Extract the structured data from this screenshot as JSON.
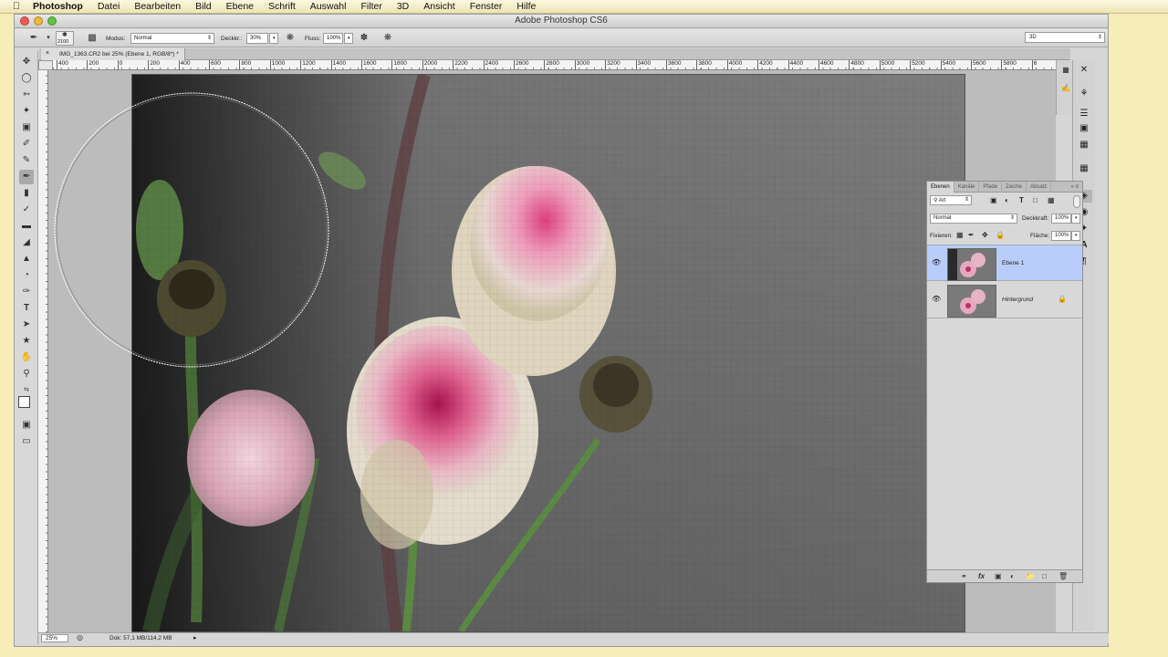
{
  "menubar": {
    "app": "Photoshop",
    "items": [
      "Datei",
      "Bearbeiten",
      "Bild",
      "Ebene",
      "Schrift",
      "Auswahl",
      "Filter",
      "3D",
      "Ansicht",
      "Fenster",
      "Hilfe"
    ]
  },
  "window": {
    "title": "Adobe Photoshop CS6"
  },
  "options": {
    "brush_size": "2100",
    "mode_label": "Modus:",
    "mode_value": "Normal",
    "opacity_label": "Deckkr.:",
    "opacity_value": "30%",
    "flow_label": "Fluss:",
    "flow_value": "100%",
    "workspace": "3D"
  },
  "document": {
    "tab": "IMG_1363.CR2 bei 25% (Ebene 1, RGB/8*) *"
  },
  "ruler": {
    "h": [
      "400",
      "200",
      "0",
      "200",
      "400",
      "600",
      "800",
      "1000",
      "1200",
      "1400",
      "1600",
      "1800",
      "2000",
      "2200",
      "2400",
      "2600",
      "2800",
      "3000",
      "3200",
      "3400",
      "3600",
      "3800",
      "4000",
      "4200",
      "4400",
      "4600",
      "4800",
      "5000",
      "5200",
      "5400",
      "5600",
      "5800",
      "6"
    ]
  },
  "status": {
    "zoom": "25%",
    "doc": "Dok: 57,1 MB/114,2 MB"
  },
  "layers_panel": {
    "tabs": [
      "Ebenen",
      "Kanäle",
      "Pfade",
      "Zeiche",
      "Absatz"
    ],
    "filter": "Art",
    "blend": "Normal",
    "opacity_label": "Deckkraft:",
    "opacity_value": "100%",
    "lock_label": "Fixieren:",
    "fill_label": "Fläche:",
    "fill_value": "100%",
    "layers": [
      {
        "name": "Ebene 1",
        "selected": true
      },
      {
        "name": "Hintergrund",
        "selected": false
      }
    ]
  },
  "icons": {
    "brush": "brush-icon",
    "eye": "eye-icon",
    "lock": "lock-icon",
    "apple": "apple-icon"
  }
}
